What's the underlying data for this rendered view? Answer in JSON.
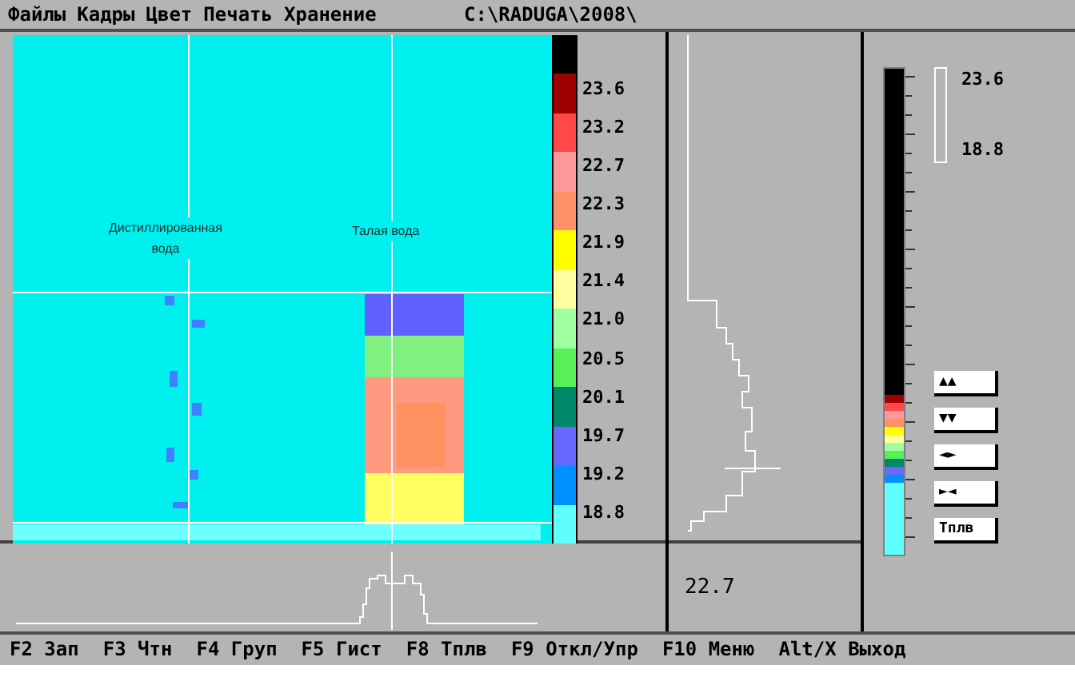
{
  "menu": [
    "Файлы",
    "Кадры",
    "Цвет",
    "Печать",
    "Хранение"
  ],
  "path": "C:\\RADUGA\\2008\\",
  "image": {
    "labels": [
      "Дистиллированная\nвода",
      "Талая вода"
    ]
  },
  "legend": [
    {
      "color": "#000000"
    },
    {
      "color": "#a00000",
      "label": "23.6"
    },
    {
      "color": "#ff4848",
      "label": "23.2"
    },
    {
      "color": "#ff9898",
      "label": "22.7"
    },
    {
      "color": "#ff9068",
      "label": "22.3"
    },
    {
      "color": "#ffff00",
      "label": "21.9"
    },
    {
      "color": "#ffffa0",
      "label": "21.4"
    },
    {
      "color": "#a0ffa0",
      "label": "21.0"
    },
    {
      "color": "#58f058",
      "label": "20.5"
    },
    {
      "color": "#008868",
      "label": "20.1"
    },
    {
      "color": "#6868ff",
      "label": "19.7"
    },
    {
      "color": "#0090ff",
      "label": "19.2"
    },
    {
      "color": "#60ffff",
      "label": "18.8"
    }
  ],
  "value": "22.7",
  "range": {
    "max": "23.6",
    "min": "18.8"
  },
  "buttons": [
    "▲▲",
    "▼▼",
    "◄►",
    "►◄",
    "Тплв"
  ],
  "fkeys": [
    {
      "key": "F2",
      "label": "Зап"
    },
    {
      "key": "F3",
      "label": "Чтн"
    },
    {
      "key": "F4",
      "label": "Груп"
    },
    {
      "key": "F5",
      "label": "Гист"
    },
    {
      "key": "F8",
      "label": "Тплв"
    },
    {
      "key": "F9",
      "label": "Откл/Упр"
    },
    {
      "key": "F10",
      "label": "Меню"
    },
    {
      "key": "Alt/X",
      "label": "Выход"
    }
  ]
}
